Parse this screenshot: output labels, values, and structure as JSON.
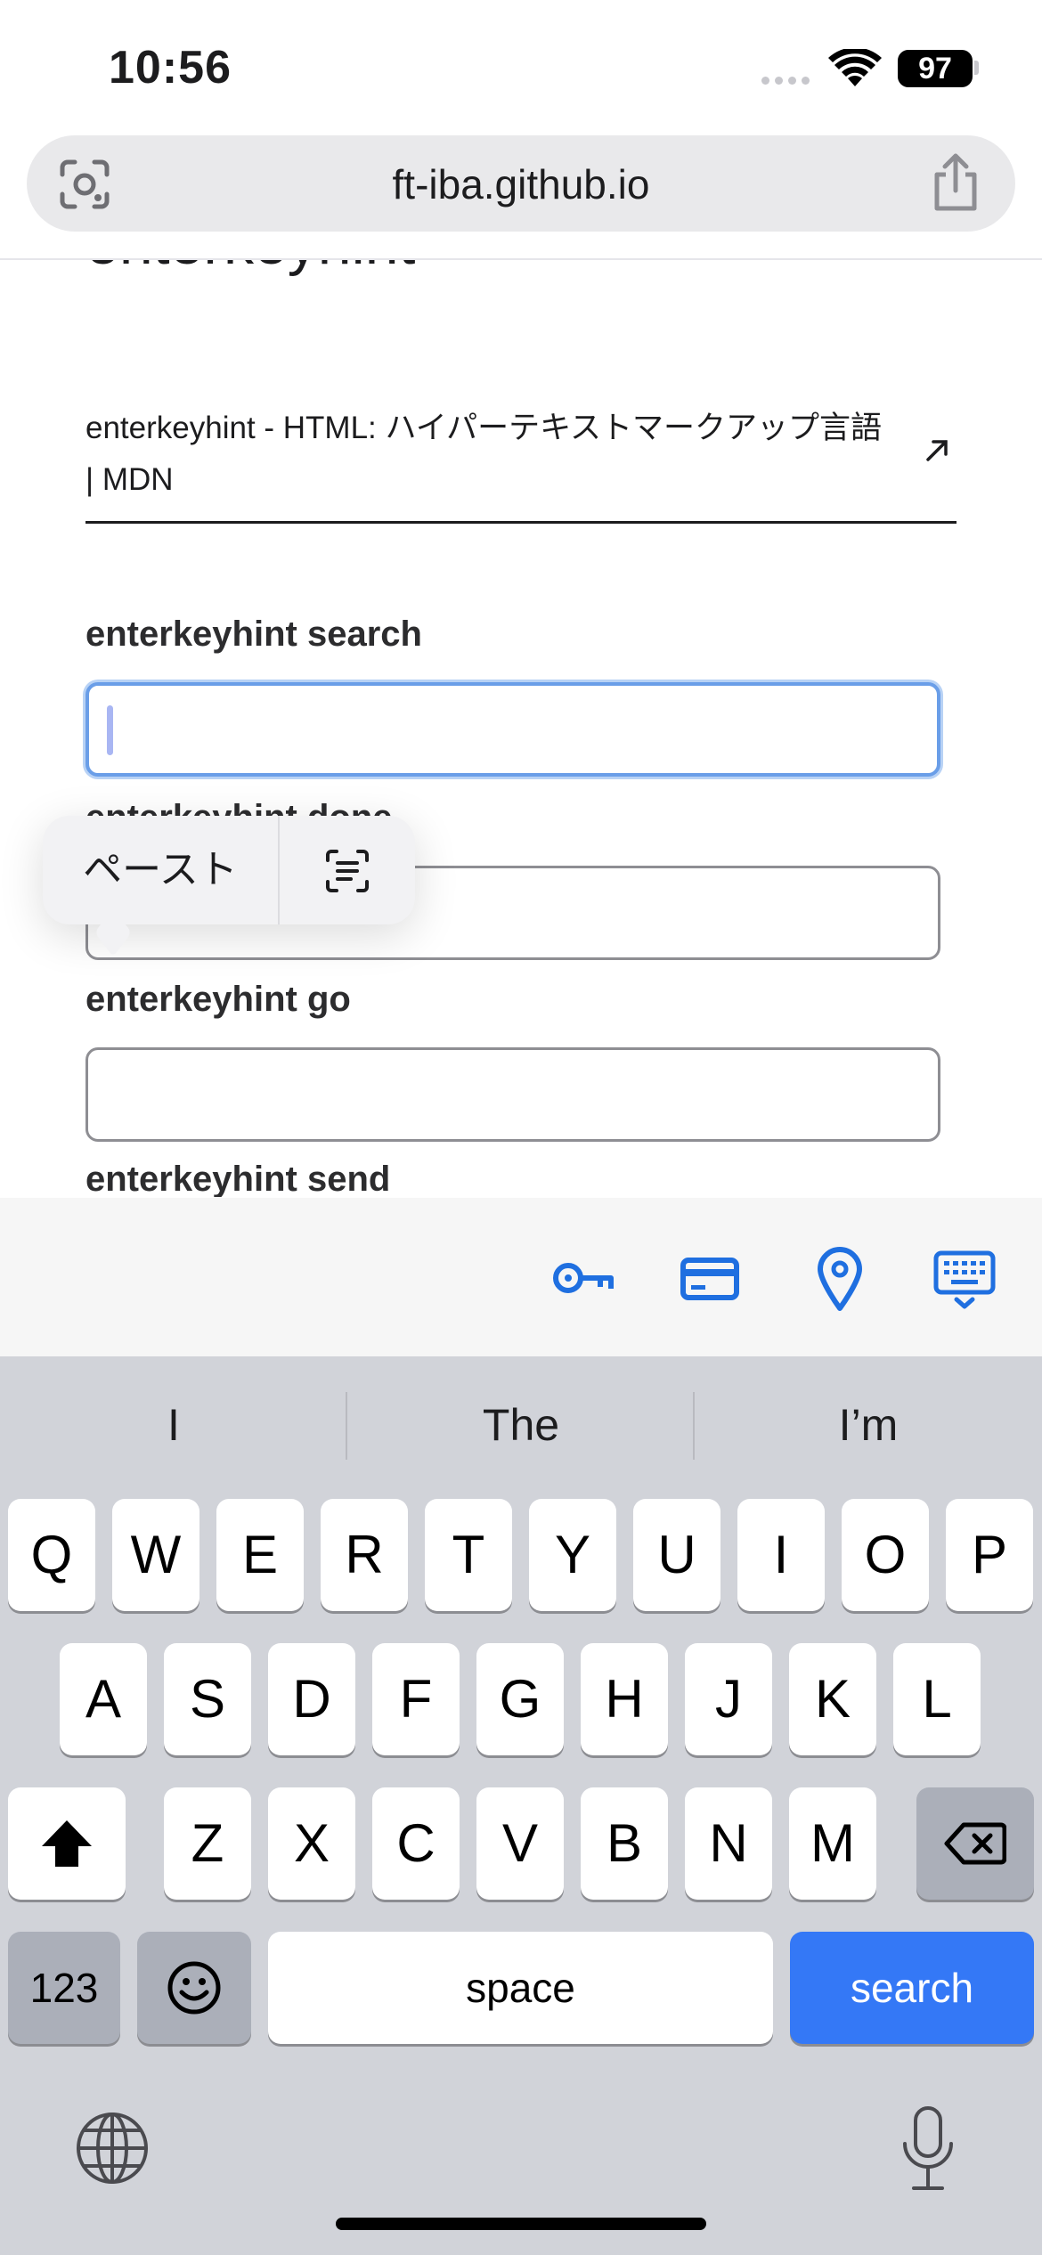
{
  "status_bar": {
    "time": "10:56",
    "battery": "97"
  },
  "url_bar": {
    "domain": "ft-iba.github.io"
  },
  "page": {
    "heading": "enterkeyhint",
    "mdn_link": "enterkeyhint - HTML: ハイパーテキストマークアップ言語 | MDN",
    "fields": [
      {
        "label": "enterkeyhint search"
      },
      {
        "label": "enterkeyhint done"
      },
      {
        "label": "enterkeyhint go"
      },
      {
        "label": "enterkeyhint send"
      }
    ]
  },
  "edit_menu": {
    "paste": "ペースト"
  },
  "accessory": {
    "icons": [
      "key-icon",
      "credit-card-icon",
      "location-pin-icon",
      "keyboard-dismiss-icon"
    ]
  },
  "keyboard": {
    "suggestions": [
      "I",
      "The",
      "I’m"
    ],
    "row1": [
      "Q",
      "W",
      "E",
      "R",
      "T",
      "Y",
      "U",
      "I",
      "O",
      "P"
    ],
    "row2": [
      "A",
      "S",
      "D",
      "F",
      "G",
      "H",
      "J",
      "K",
      "L"
    ],
    "row3": [
      "Z",
      "X",
      "C",
      "V",
      "B",
      "N",
      "M"
    ],
    "numbers_key": "123",
    "space_key": "space",
    "return_key": "search"
  },
  "colors": {
    "accent": "#3478f6",
    "keyboard_bg": "#d1d3d9",
    "focus_ring": "#6a9ee8"
  }
}
